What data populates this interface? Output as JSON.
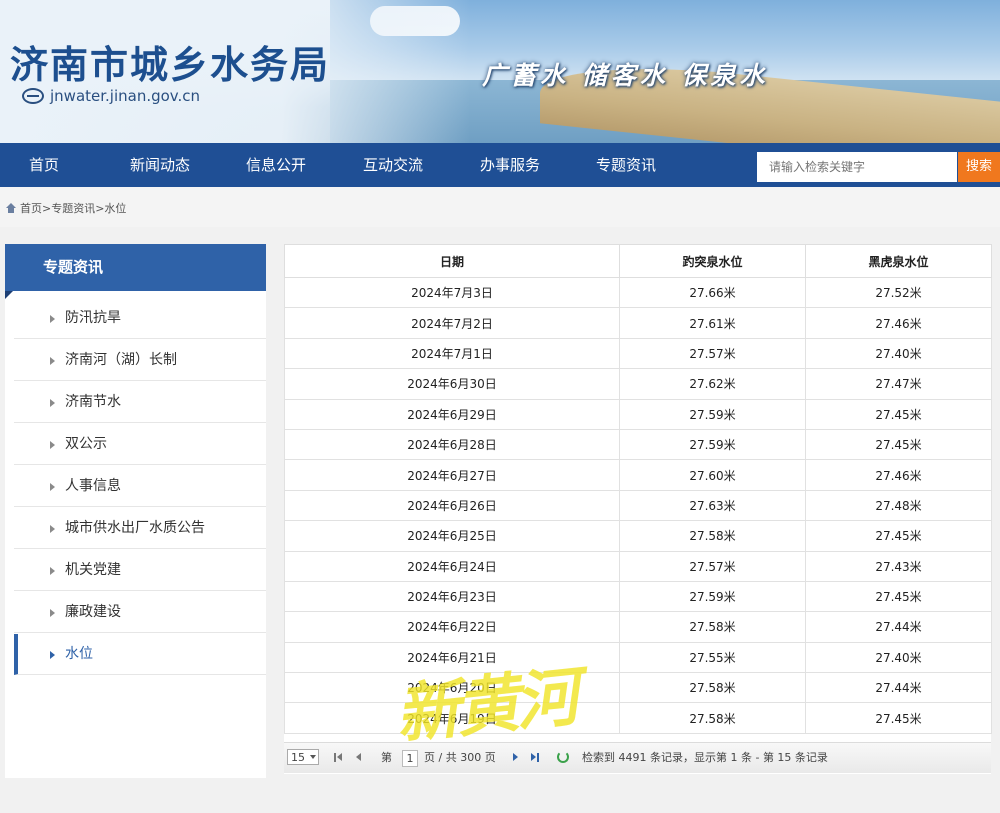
{
  "header": {
    "title": "济南市城乡水务局",
    "url": "jnwater.jinan.gov.cn",
    "slogan": "广蓄水 储客水 保泉水"
  },
  "nav": {
    "items": [
      "首页",
      "新闻动态",
      "信息公开",
      "互动交流",
      "办事服务",
      "专题资讯"
    ],
    "search_placeholder": "请输入检索关键字",
    "search_button": "搜索"
  },
  "breadcrumb": "首页>专题资讯>水位",
  "sidebar": {
    "title": "专题资讯",
    "items": [
      "防汛抗旱",
      "济南河（湖）长制",
      "济南节水",
      "双公示",
      "人事信息",
      "城市供水出厂水质公告",
      "机关党建",
      "廉政建设",
      "水位"
    ],
    "active": "水位"
  },
  "table": {
    "columns": [
      "日期",
      "趵突泉水位",
      "黑虎泉水位"
    ],
    "rows": [
      [
        "2024年7月3日",
        "27.66米",
        "27.52米"
      ],
      [
        "2024年7月2日",
        "27.61米",
        "27.46米"
      ],
      [
        "2024年7月1日",
        "27.57米",
        "27.40米"
      ],
      [
        "2024年6月30日",
        "27.62米",
        "27.47米"
      ],
      [
        "2024年6月29日",
        "27.59米",
        "27.45米"
      ],
      [
        "2024年6月28日",
        "27.59米",
        "27.45米"
      ],
      [
        "2024年6月27日",
        "27.60米",
        "27.46米"
      ],
      [
        "2024年6月26日",
        "27.63米",
        "27.48米"
      ],
      [
        "2024年6月25日",
        "27.58米",
        "27.45米"
      ],
      [
        "2024年6月24日",
        "27.57米",
        "27.43米"
      ],
      [
        "2024年6月23日",
        "27.59米",
        "27.45米"
      ],
      [
        "2024年6月22日",
        "27.58米",
        "27.44米"
      ],
      [
        "2024年6月21日",
        "27.55米",
        "27.40米"
      ],
      [
        "2024年6月20日",
        "27.58米",
        "27.44米"
      ],
      [
        "2024年6月19日",
        "27.58米",
        "27.45米"
      ]
    ]
  },
  "pager": {
    "page_size": "15",
    "page_prefix": "第",
    "current_page": "1",
    "page_suffix": "页 / 共 300 页",
    "summary": "检索到 4491 条记录，显示第 1 条 - 第 15 条记录"
  },
  "watermark": "新黄河"
}
